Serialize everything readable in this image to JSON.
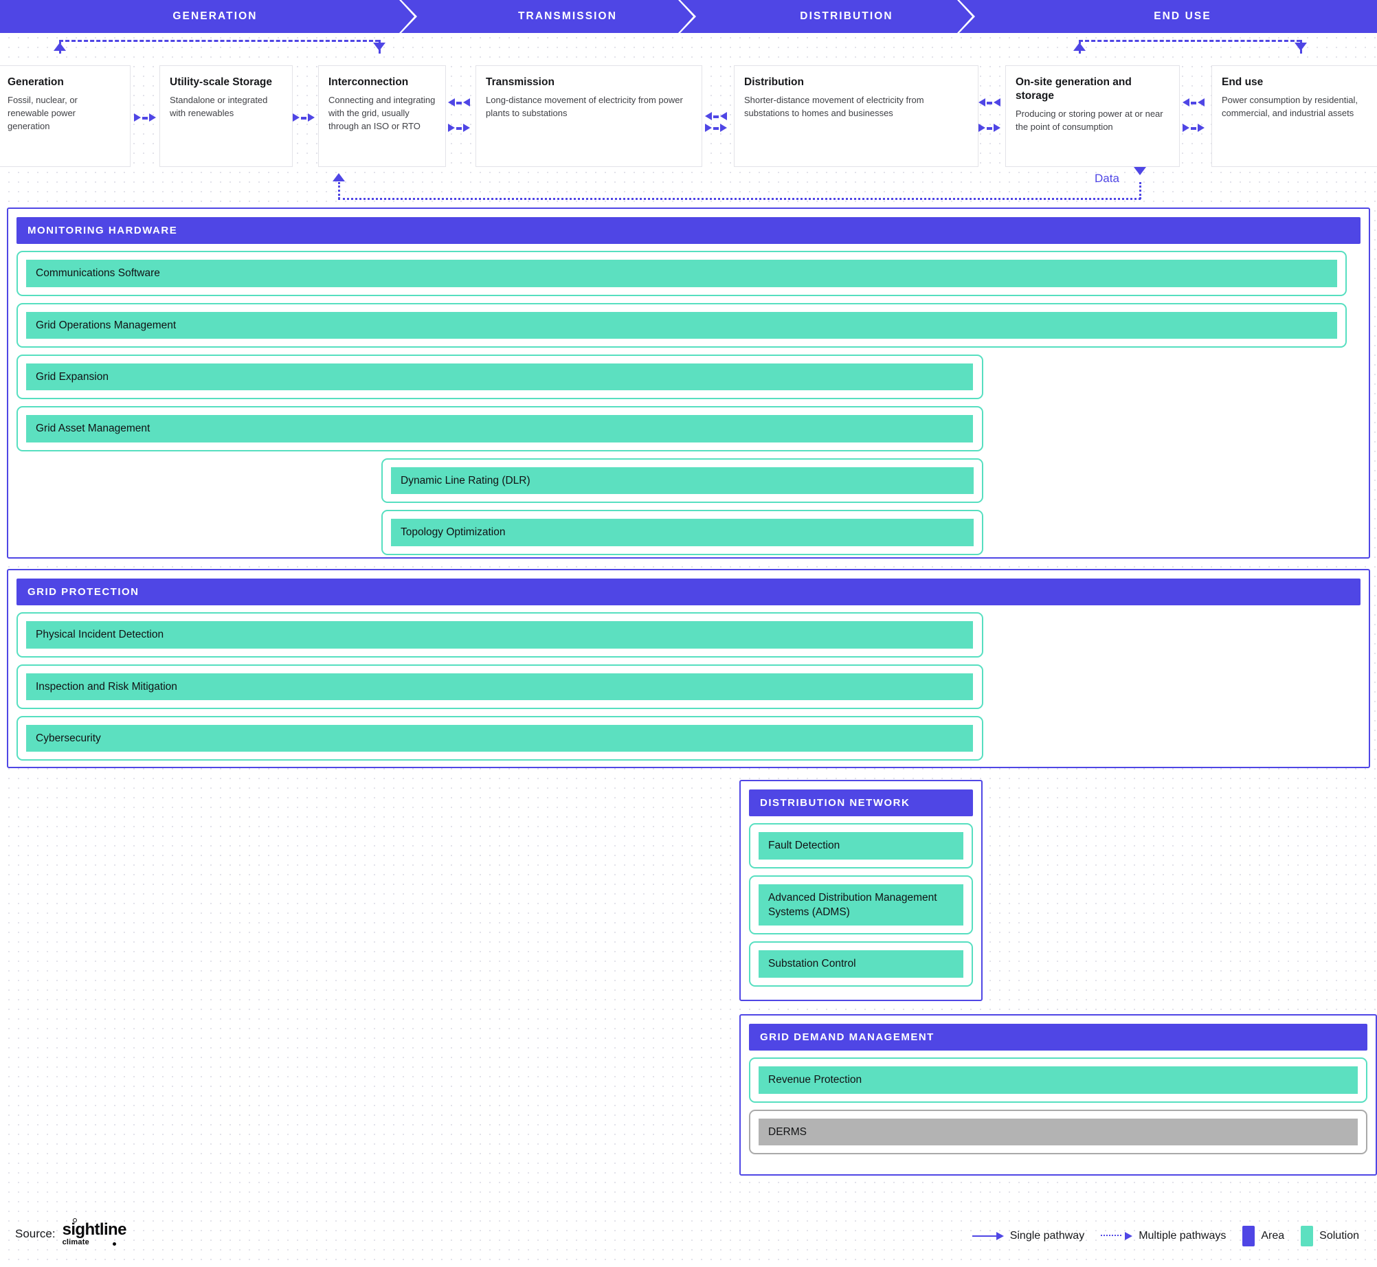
{
  "colors": {
    "area_purple": "#4f46e5",
    "solution_green": "#5ce0c0",
    "solution_border": "#56dfc0",
    "inactive_grey": "#b3b3b3",
    "card_border": "#e3e3e8",
    "text_dark": "#16171a"
  },
  "phases": [
    {
      "label": "GENERATION"
    },
    {
      "label": "TRANSMISSION"
    },
    {
      "label": "DISTRIBUTION"
    },
    {
      "label": "END USE"
    }
  ],
  "value_chain": [
    {
      "title": "Generation",
      "desc": "Fossil, nuclear, or renewable power generation"
    },
    {
      "title": "Utility-scale Storage",
      "desc": "Standalone or integrated with renewables"
    },
    {
      "title": "Interconnection",
      "desc": "Connecting and integrating with the grid, usually through an ISO or RTO"
    },
    {
      "title": "Transmission",
      "desc": "Long-distance movement of electricity from power plants to substations"
    },
    {
      "title": "Distribution",
      "desc": "Shorter-distance movement of electricity from substations to homes and businesses"
    },
    {
      "title": "On-site generation and storage",
      "desc": "Producing or storing power at or near the point of consumption"
    },
    {
      "title": "End use",
      "desc": "Power consumption by residential, commercial, and industrial assets"
    }
  ],
  "data_flow_label": "Data",
  "areas": [
    {
      "id": "monitoring-hardware",
      "title": "MONITORING HARDWARE",
      "solutions": [
        {
          "label": "Communications Software",
          "state": "active"
        },
        {
          "label": "Grid Operations Management",
          "state": "active"
        },
        {
          "label": "Grid Expansion",
          "state": "active"
        },
        {
          "label": "Grid Asset Management",
          "state": "active"
        },
        {
          "label": "Dynamic Line Rating (DLR)",
          "state": "active"
        },
        {
          "label": "Topology Optimization",
          "state": "active"
        }
      ]
    },
    {
      "id": "grid-protection",
      "title": "GRID PROTECTION",
      "solutions": [
        {
          "label": "Physical Incident Detection",
          "state": "active"
        },
        {
          "label": "Inspection and Risk Mitigation",
          "state": "active"
        },
        {
          "label": "Cybersecurity",
          "state": "active"
        }
      ]
    },
    {
      "id": "distribution-network",
      "title": "DISTRIBUTION NETWORK",
      "solutions": [
        {
          "label": "Fault Detection",
          "state": "active"
        },
        {
          "label": "Advanced Distribution Management Systems (ADMS)",
          "state": "active"
        },
        {
          "label": "Substation Control",
          "state": "active"
        }
      ]
    },
    {
      "id": "grid-demand-management",
      "title": "GRID DEMAND MANAGEMENT",
      "solutions": [
        {
          "label": "Revenue Protection",
          "state": "active"
        },
        {
          "label": "DERMS",
          "state": "inactive"
        }
      ]
    }
  ],
  "footer": {
    "source_label": "Source:",
    "logo_line1": "sightline",
    "logo_line2": "climate",
    "legend": [
      {
        "key": "single-pathway",
        "label": "Single pathway"
      },
      {
        "key": "multiple-pathways",
        "label": "Multiple pathways"
      },
      {
        "key": "area",
        "label": "Area"
      },
      {
        "key": "solution",
        "label": "Solution"
      }
    ]
  }
}
